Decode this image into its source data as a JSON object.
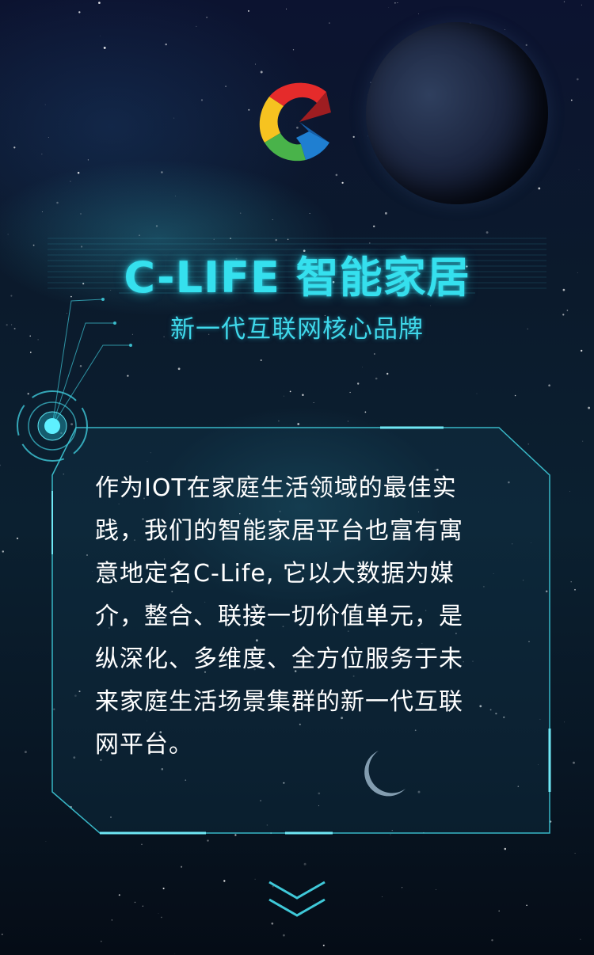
{
  "hero": {
    "logo": {
      "name": "c-life-logo",
      "colors": [
        "#e52b2b",
        "#f6c320",
        "#49b34a",
        "#1f7fd1"
      ]
    },
    "title": "C-LIFE 智能家居",
    "subtitle": "新一代互联网核心品牌"
  },
  "panel": {
    "lines": [
      "作为IOT在家庭生活领域的最佳实",
      "践，我们的智能家居平台也富有寓",
      "意地定名C-Life, 它以大数据为媒",
      "介，整合、联接一切价值单元，是",
      "纵深化、多维度、全方位服务于未",
      "来家庭生活场景集群的新一代互联",
      "网平台。"
    ],
    "border_color": "#3fc9d9"
  },
  "navigation": {
    "scroll_hint_icon": "double-chevron-down-icon"
  },
  "theme": {
    "accent": "#35e0ee",
    "background": "#0b1a2c"
  }
}
